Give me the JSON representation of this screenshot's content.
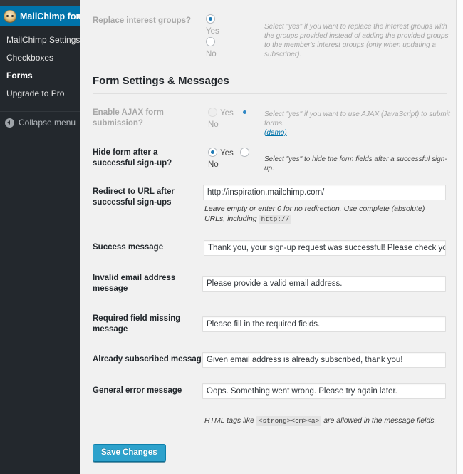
{
  "sidebar": {
    "brand": "MailChimp for WR",
    "brand_icon": "monkey-avatar-icon",
    "items": [
      {
        "label": "MailChimp Settings",
        "active": false
      },
      {
        "label": "Checkboxes",
        "active": false
      },
      {
        "label": "Forms",
        "active": true
      },
      {
        "label": "Upgrade to Pro",
        "active": false
      }
    ],
    "collapse": {
      "label": "Collapse menu",
      "icon": "collapse-left-arrow-icon"
    }
  },
  "rows": {
    "replace_groups": {
      "label": "Replace interest groups?",
      "yes": "Yes",
      "no": "No",
      "selected": "Yes",
      "description": "Select \"yes\" if you want to replace the interest groups with the groups provided instead of adding the provided groups to the member's interest groups (only when updating a subscriber)."
    },
    "section_heading": "Form Settings & Messages",
    "ajax": {
      "label": "Enable AJAX form submission?",
      "yes": "Yes",
      "no": "No",
      "selected": "No",
      "description": "Select \"yes\" if you want to use AJAX (JavaScript) to submit forms.",
      "demo_link": "(demo)"
    },
    "hide_form": {
      "label": "Hide form after a successful sign-up?",
      "yes": "Yes",
      "no": "No",
      "selected": "Yes",
      "description": "Select \"yes\" to hide the form fields after a successful sign-up."
    },
    "redirect": {
      "label": "Redirect to URL after successful sign-ups",
      "value": "http://inspiration.mailchimp.com/",
      "helper_before": "Leave empty or enter 0 for no redirection. Use complete (absolute) URLs, including",
      "helper_code": "http://"
    },
    "success_message": {
      "label": "Success message",
      "value": "Thank you, your sign-up request was successful! Please check your"
    },
    "invalid_email_message": {
      "label": "Invalid email address message",
      "value": "Please provide a valid email address."
    },
    "required_field_message": {
      "label": "Required field missing message",
      "value": "Please fill in the required fields."
    },
    "already_subscribed_message": {
      "label": "Already subscribed message",
      "value": "Given email address is already subscribed, thank you!"
    },
    "general_error_message": {
      "label": "General error message",
      "value": "Oops. Something went wrong. Please try again later."
    },
    "html_note": {
      "before": "HTML tags like",
      "code": "<strong><em><a>",
      "after": "are allowed in the message fields."
    }
  },
  "footer": {
    "save_label": "Save Changes"
  },
  "colors": {
    "sidebar_bg": "#23282d",
    "brand_blue": "#0073aa",
    "save_blue": "#2ea2cc",
    "page_bg": "#f1f1f1"
  }
}
